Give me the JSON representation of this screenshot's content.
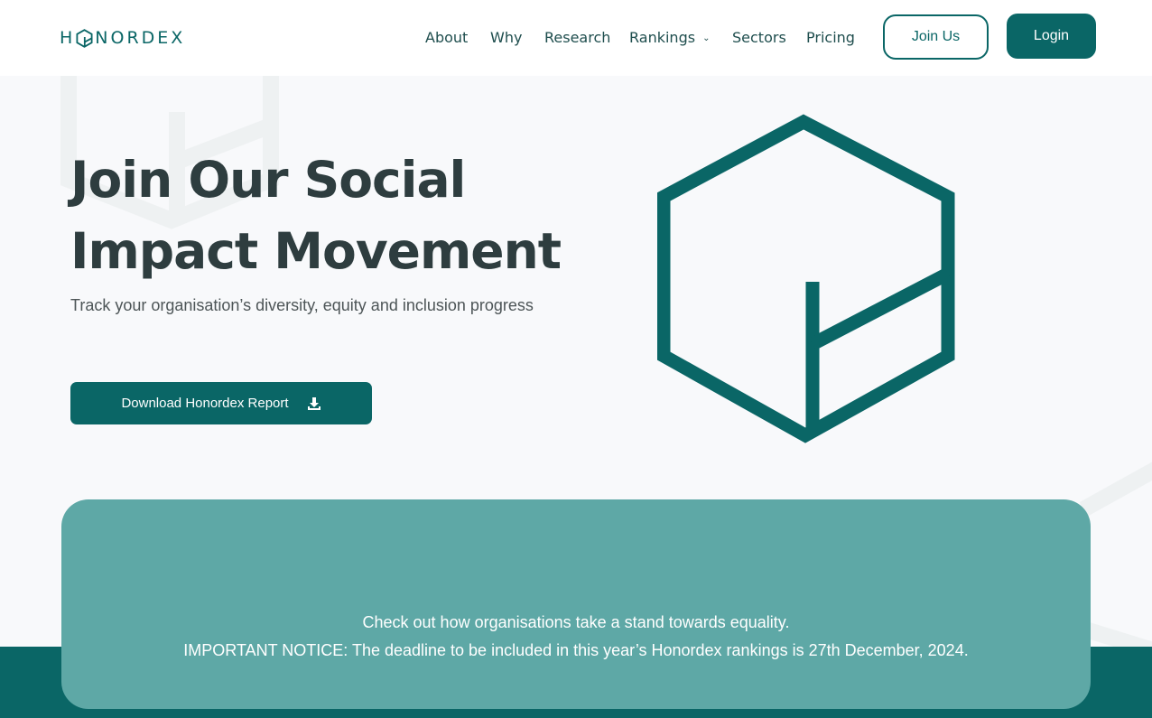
{
  "colors": {
    "brand": "#0a6666",
    "notice_card": "#5ea8a6",
    "heading": "#2e3d3f",
    "background": "#f8f9fb"
  },
  "header": {
    "logo_prefix": "H",
    "logo_suffix": "NORDEX",
    "logo_icon": "hexagon-logo-icon",
    "nav": [
      {
        "label": "About"
      },
      {
        "label": "Why"
      },
      {
        "label": "Research"
      },
      {
        "label": "Rankings",
        "has_dropdown": true
      },
      {
        "label": "Sectors"
      },
      {
        "label": "Pricing"
      }
    ],
    "join_label": "Join Us",
    "login_label": "Login"
  },
  "hero": {
    "title_line1": "Join Our Social",
    "title_line2": "Impact Movement",
    "subtitle": "Track your organisation’s diversity, equity and inclusion progress",
    "download_label": "Download Honordex Report",
    "download_icon": "download-icon",
    "illustration_icon": "honordex-hexagon-icon"
  },
  "notice": {
    "line1": "Check out how organisations take a stand towards equality.",
    "line2": "IMPORTANT NOTICE: The deadline to be included in this year’s Honordex rankings is 27th December, 2024."
  }
}
